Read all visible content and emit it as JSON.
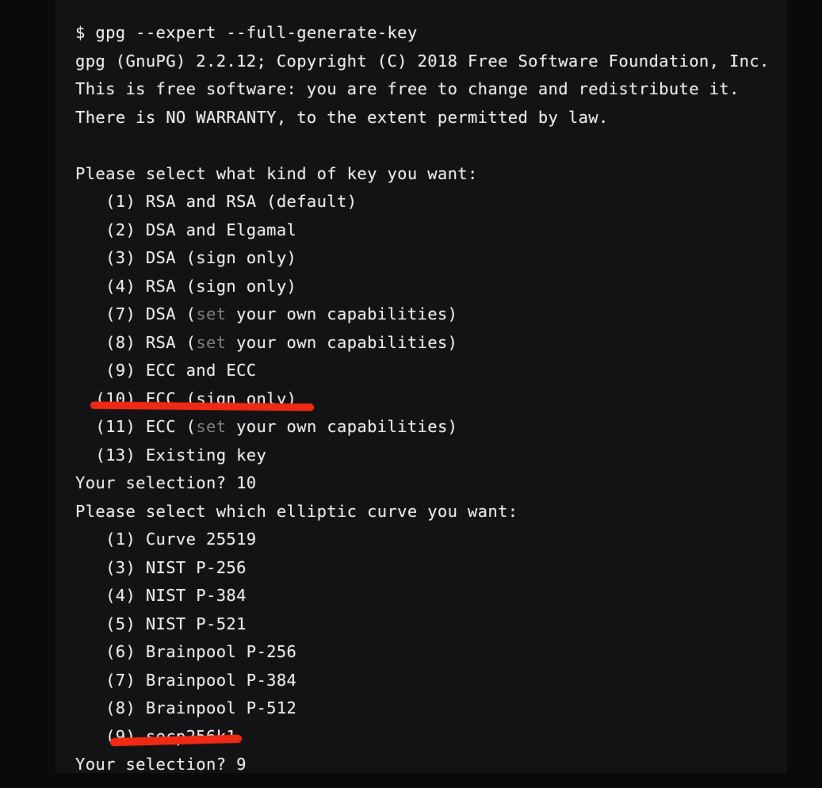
{
  "terminal": {
    "prompt_symbol": "$",
    "command": "gpg --expert --full-generate-key",
    "command_line": "$ gpg --expert --full-generate-key",
    "background_color": "#131315",
    "text_color": "#e9e9ea",
    "dim_text_color": "#7e7e82",
    "annotation_color": "#ef2a14",
    "banner": [
      "gpg (GnuPG) 2.2.12; Copyright (C) 2018 Free Software Foundation, Inc.",
      "This is free software: you are free to change and redistribute it.",
      "There is NO WARRANTY, to the extent permitted by law."
    ],
    "key_prompt": {
      "question": "Please select what kind of key you want:",
      "options": [
        {
          "number": "(1)",
          "indent": "   ",
          "pre": " RSA and RSA (default)",
          "dim": "",
          "post": ""
        },
        {
          "number": "(2)",
          "indent": "   ",
          "pre": " DSA and Elgamal",
          "dim": "",
          "post": ""
        },
        {
          "number": "(3)",
          "indent": "   ",
          "pre": " DSA (sign only)",
          "dim": "",
          "post": ""
        },
        {
          "number": "(4)",
          "indent": "   ",
          "pre": " RSA (sign only)",
          "dim": "",
          "post": ""
        },
        {
          "number": "(7)",
          "indent": "   ",
          "pre": " DSA (",
          "dim": "set",
          "post": " your own capabilities)"
        },
        {
          "number": "(8)",
          "indent": "   ",
          "pre": " RSA (",
          "dim": "set",
          "post": " your own capabilities)"
        },
        {
          "number": "(9)",
          "indent": "   ",
          "pre": " ECC and ECC",
          "dim": "",
          "post": ""
        },
        {
          "number": "(10)",
          "indent": "  ",
          "pre": " ECC (sign only)",
          "dim": "",
          "post": ""
        },
        {
          "number": "(11)",
          "indent": "  ",
          "pre": " ECC (",
          "dim": "set",
          "post": " your own capabilities)"
        },
        {
          "number": "(13)",
          "indent": "  ",
          "pre": " Existing key",
          "dim": "",
          "post": ""
        }
      ],
      "selection_prompt": "Your selection? ",
      "selection_value": "10",
      "selection_line": "Your selection? 10"
    },
    "curve_prompt": {
      "question": "Please select which elliptic curve you want:",
      "options": [
        {
          "number": "(1)",
          "indent": "   ",
          "label": " Curve 25519"
        },
        {
          "number": "(3)",
          "indent": "   ",
          "label": " NIST P-256"
        },
        {
          "number": "(4)",
          "indent": "   ",
          "label": " NIST P-384"
        },
        {
          "number": "(5)",
          "indent": "   ",
          "label": " NIST P-521"
        },
        {
          "number": "(6)",
          "indent": "   ",
          "label": " Brainpool P-256"
        },
        {
          "number": "(7)",
          "indent": "   ",
          "label": " Brainpool P-384"
        },
        {
          "number": "(8)",
          "indent": "   ",
          "label": " Brainpool P-512"
        },
        {
          "number": "(9)",
          "indent": "   ",
          "label": " secp256k1"
        }
      ],
      "selection_prompt": "Your selection? ",
      "selection_value": "9",
      "selection_line": "Your selection? 9"
    },
    "annotations": [
      {
        "name": "marker-ecc-sign-only",
        "underlines_text": "(10) ECC (sign only)"
      },
      {
        "name": "marker-secp256k1",
        "underlines_text": "(9) secp256k1"
      }
    ]
  }
}
